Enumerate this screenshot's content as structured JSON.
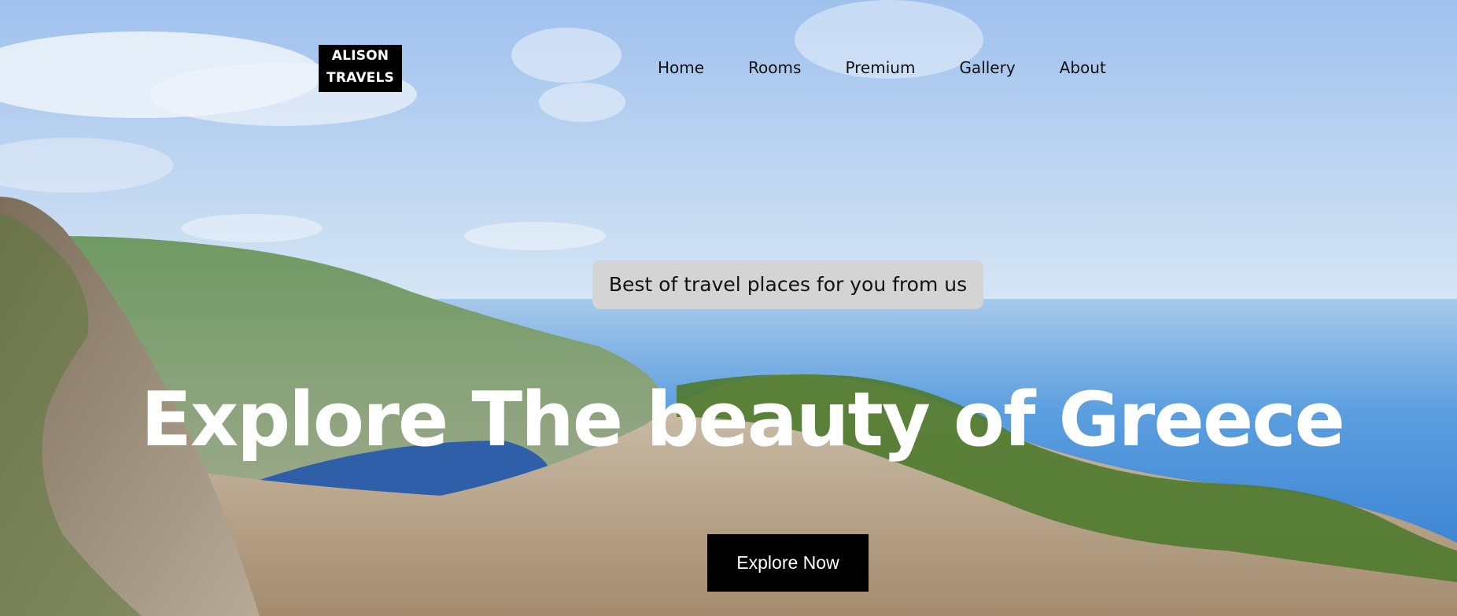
{
  "brand": {
    "line1": "ALISON",
    "line2": "TRAVELS"
  },
  "nav": {
    "items": [
      {
        "label": "Home"
      },
      {
        "label": "Rooms"
      },
      {
        "label": "Premium"
      },
      {
        "label": "Gallery"
      },
      {
        "label": "About"
      }
    ]
  },
  "hero": {
    "tagline": "Best of travel places for you from us",
    "headline": "Explore The beauty of Greece",
    "cta_label": "Explore Now"
  },
  "colors": {
    "logo_bg": "#000000",
    "cta_bg": "#000000",
    "pill_bg": "#d4d4d4",
    "headline": "#ffffff",
    "sky": "#a9c8ef",
    "sea": "#3f86d3"
  }
}
